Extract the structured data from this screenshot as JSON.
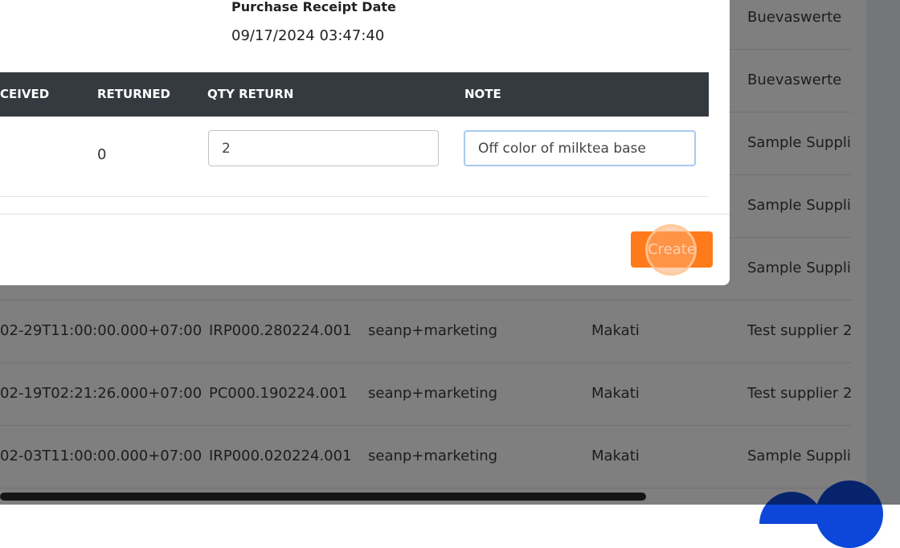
{
  "background_table": {
    "rows": [
      {
        "date": "",
        "receipt": "",
        "user": "",
        "location": "",
        "supplier": "Buevaswerte"
      },
      {
        "date": "",
        "receipt": "",
        "user": "",
        "location": "",
        "supplier": "Buevaswerte"
      },
      {
        "date": "",
        "receipt": "",
        "user": "",
        "location": "",
        "supplier": "Sample Suppli"
      },
      {
        "date": "",
        "receipt": "",
        "user": "",
        "location": "",
        "supplier": "Sample Suppli"
      },
      {
        "date": "",
        "receipt": "",
        "user": "",
        "location": "",
        "supplier": "Sample Suppli"
      },
      {
        "date": "02-29T11:00:00.000+07:00",
        "receipt": "IRP000.280224.001",
        "user": "seanp+marketing",
        "location": "Makati",
        "supplier": "Test supplier 2"
      },
      {
        "date": "02-19T02:21:26.000+07:00",
        "receipt": "PC000.190224.001",
        "user": "seanp+marketing",
        "location": "Makati",
        "supplier": "Test supplier 2"
      },
      {
        "date": "02-03T11:00:00.000+07:00",
        "receipt": "IRP000.020224.001",
        "user": "seanp+marketing",
        "location": "Makati",
        "supplier": "Sample Suppli"
      }
    ]
  },
  "modal": {
    "purchase_receipt_date_label": "Purchase Receipt Date",
    "purchase_receipt_date_value": "09/17/2024 03:47:40",
    "table": {
      "headers": {
        "received": "CEIVED",
        "returned": "RETURNED",
        "qty_return": "QTY RETURN",
        "note": "NOTE"
      },
      "row": {
        "returned": "0",
        "qty_return": "2",
        "note": "Off color of milktea base"
      }
    },
    "create_label": "Create"
  },
  "colors": {
    "accent": "#ff7a1a",
    "table_header": "#343a40",
    "fab": "#0d47d9"
  }
}
